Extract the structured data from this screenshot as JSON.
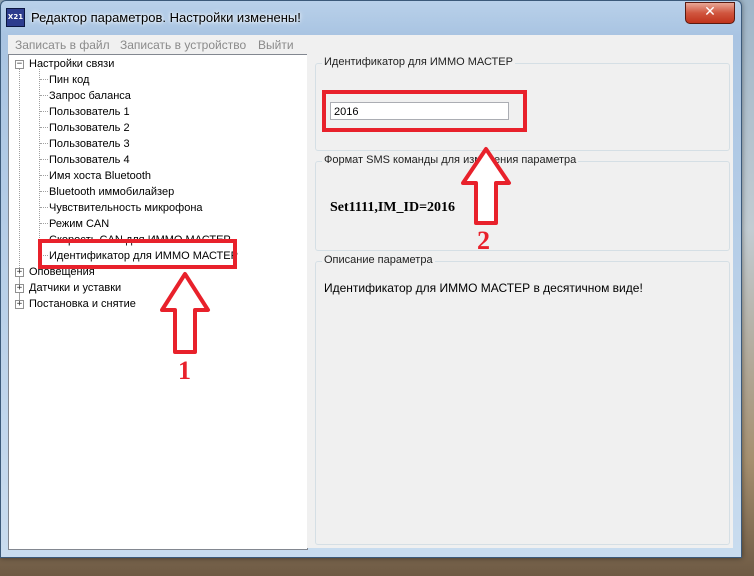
{
  "window": {
    "icon_text": "X21",
    "title": "Редактор параметров. Настройки изменены!",
    "close_glyph": "✕"
  },
  "menu": {
    "items": [
      "Записать в файл",
      "Записать в устройство",
      "Выйти"
    ]
  },
  "tree": {
    "root_expanded_label": "Настройки связи",
    "expanded_glyph": "−",
    "collapsed_glyph": "+",
    "children": [
      "Пин код",
      "Запрос баланса",
      "Пользователь 1",
      "Пользователь 2",
      "Пользователь 3",
      "Пользователь 4",
      "Имя хоста Bluetooth",
      "Bluetooth иммобилайзер",
      "Чувствительность микрофона",
      "Режим CAN",
      "Скорость CAN для ИММО МАСТЕР",
      "Идентификатор для ИММО МАСТЕР"
    ],
    "selected_index": 11,
    "collapsed_roots": [
      "Оповещения",
      "Датчики и уставки",
      "Постановка и снятие"
    ]
  },
  "panel": {
    "value_group_title": "Идентификатор для ИММО МАСТЕР",
    "value": "2016",
    "sms_group_title": "Формат SMS команды для изменения параметра",
    "sms_command": "Set1111,IM_ID=2016",
    "desc_group_title": "Описание параметра",
    "description": "Идентификатор для ИММО МАСТЕР в десятичном виде!"
  },
  "annotations": {
    "marker_1": "1",
    "marker_2": "2",
    "color": "#e8212b"
  }
}
